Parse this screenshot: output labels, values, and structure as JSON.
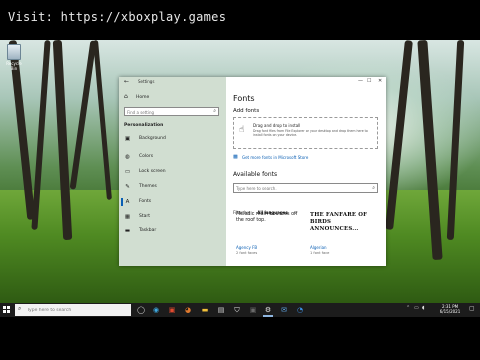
{
  "banner": {
    "text": "Visit: https://xboxplay.games"
  },
  "desktop": {
    "recycle_bin_label": "Recycle Bin"
  },
  "settings": {
    "app_title": "Settings",
    "home_label": "Home",
    "search_placeholder": "Find a setting",
    "section_label": "Personalization",
    "nav_items": [
      {
        "label": "Background",
        "icon": "picture-icon"
      },
      {
        "label": "Colors",
        "icon": "palette-icon"
      },
      {
        "label": "Lock screen",
        "icon": "lock-screen-icon"
      },
      {
        "label": "Themes",
        "icon": "brush-icon"
      },
      {
        "label": "Fonts",
        "icon": "font-icon"
      },
      {
        "label": "Start",
        "icon": "start-icon"
      },
      {
        "label": "Taskbar",
        "icon": "taskbar-icon"
      }
    ],
    "active_nav": "Fonts",
    "page_title": "Fonts",
    "add_fonts_title": "Add fonts",
    "drop_title": "Drag and drop to install",
    "drop_desc": "Drag font files from File Explorer or your desktop and drop them here to install fonts on your device.",
    "store_link": "Get more fonts in Microsoft Store",
    "available_fonts_title": "Available fonts",
    "fonts_search_placeholder": "Type here to search.",
    "filter_label": "Filter by:",
    "filter_value": "All languages",
    "fonts": [
      {
        "preview": "Melodic main bounces off the roof top.",
        "name": "Agency FB",
        "faces": "2 font faces"
      },
      {
        "preview": "THE FANFARE OF BIRDS ANNOUNCES...",
        "name": "Algerian",
        "faces": "1 font face"
      }
    ]
  },
  "taskbar": {
    "search_placeholder": "Type here to search",
    "time": "2:31 PM",
    "date": "6/15/2021"
  },
  "colors": {
    "accent": "#0a5fb4",
    "taskbar": "#1c1c1c",
    "sidebar": "#cedccd"
  }
}
